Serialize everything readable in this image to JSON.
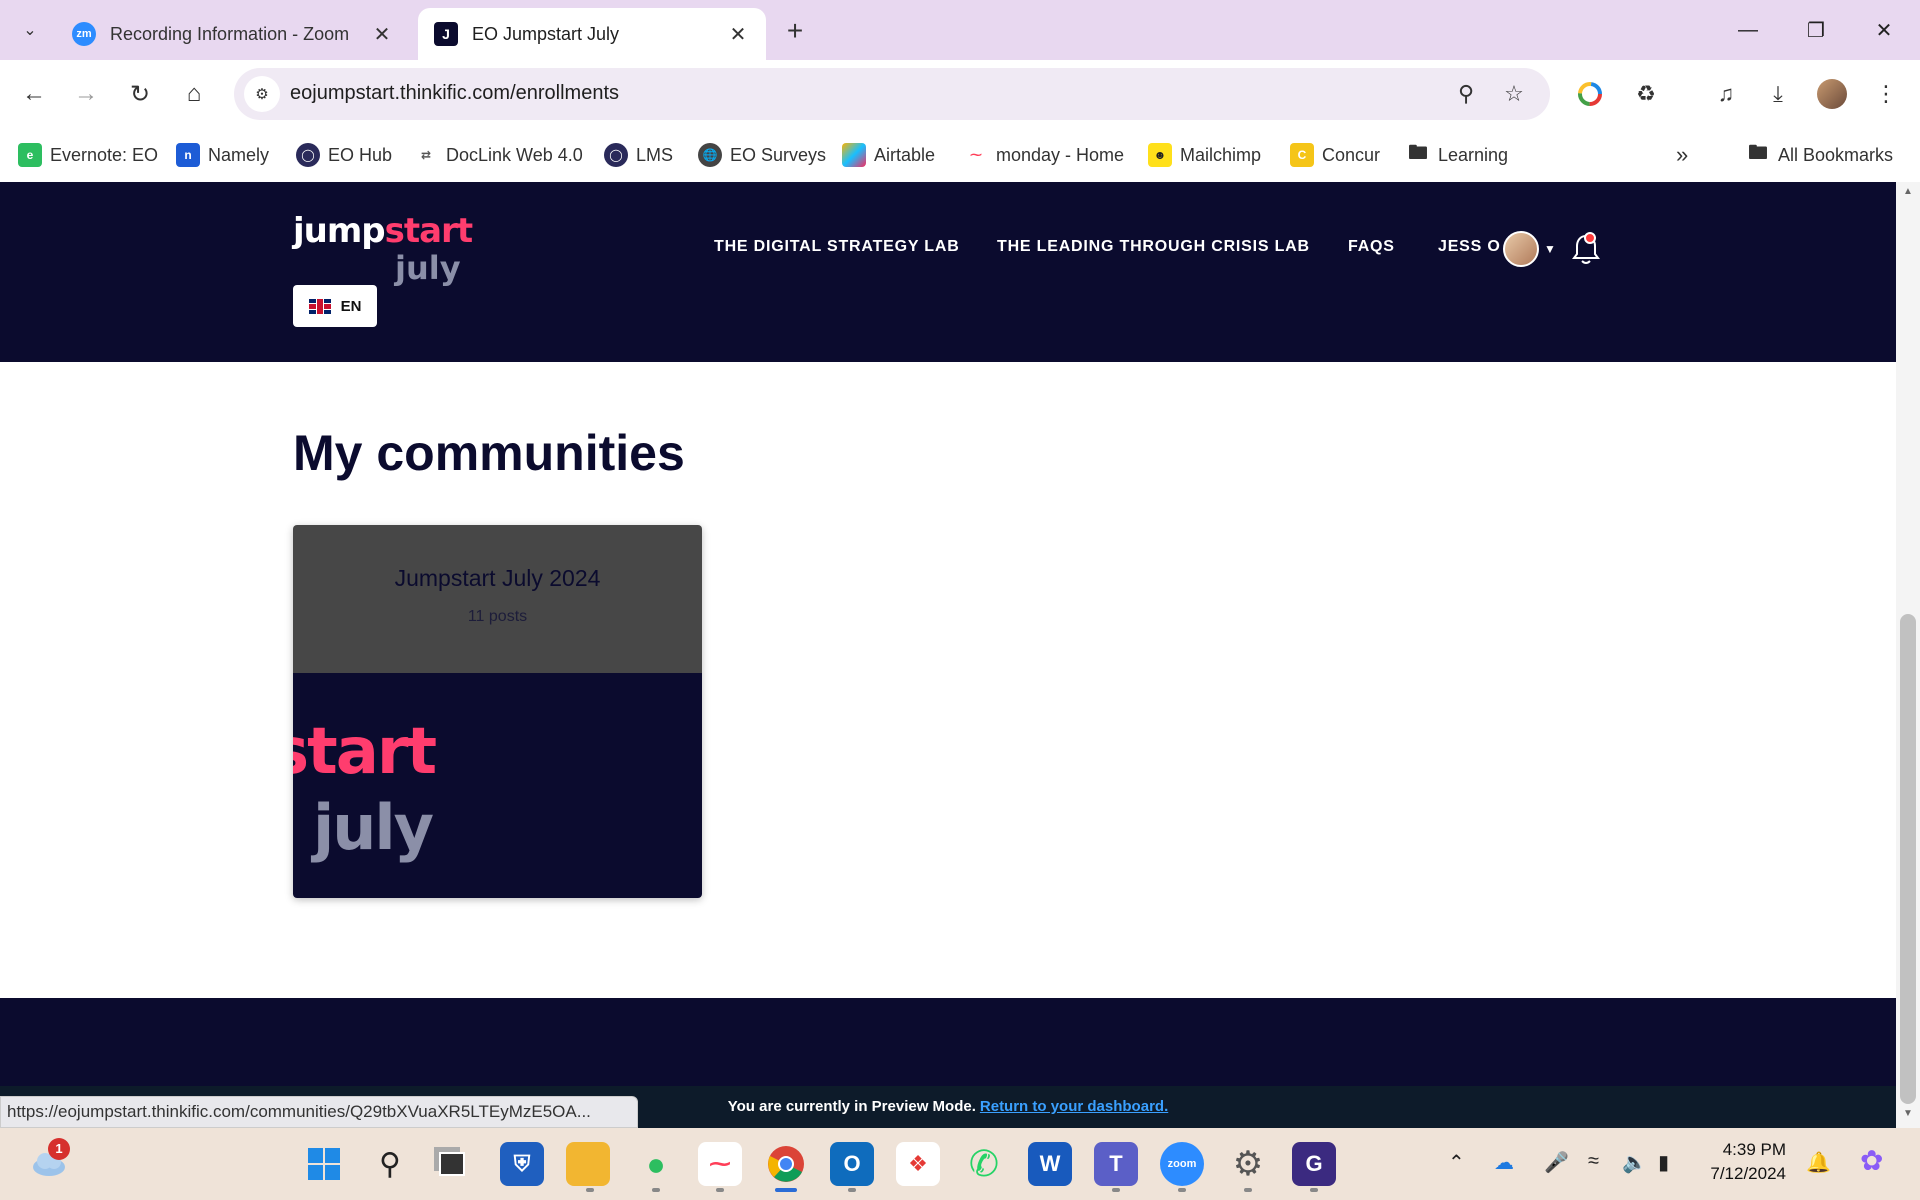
{
  "browser": {
    "tabs": [
      {
        "title": "Recording Information - Zoom",
        "favicon": "zm"
      },
      {
        "title": "EO Jumpstart July",
        "favicon": "J"
      }
    ],
    "url": "eojumpstart.thinkific.com/enrollments",
    "status_url": "https://eojumpstart.thinkific.com/communities/Q29tbXVuaXR5LTEyMzE5OA..."
  },
  "bookmarks": [
    {
      "label": "Evernote: EO",
      "color": "#2dbe60"
    },
    {
      "label": "Namely",
      "color": "#1d5cd6"
    },
    {
      "label": "EO Hub",
      "color": "#2a2a5a"
    },
    {
      "label": "DocLink Web 4.0",
      "color": "#555555"
    },
    {
      "label": "LMS",
      "color": "#2a2a5a"
    },
    {
      "label": "EO Surveys",
      "color": "#444444"
    },
    {
      "label": "Airtable",
      "color": "#fcb400"
    },
    {
      "label": "monday - Home",
      "color": "#ff3d57"
    },
    {
      "label": "Mailchimp",
      "color": "#ffe01b"
    },
    {
      "label": "Concur",
      "color": "#f5c518"
    },
    {
      "label": "Learning",
      "color": "#ffffff"
    }
  ],
  "bookmarks_all": "All Bookmarks",
  "site": {
    "logo_top": "jump",
    "logo_top_accent": "start",
    "logo_bottom": "july",
    "language": "EN",
    "nav": [
      "THE DIGITAL STRATEGY LAB",
      "THE LEADING THROUGH CRISIS LAB",
      "FAQS",
      "JESS O"
    ]
  },
  "main": {
    "title": "My communities",
    "communities": [
      {
        "name": "Jumpstart July 2024",
        "posts": "11 posts",
        "image_text_1": "start",
        "image_text_2": "july"
      }
    ]
  },
  "preview": {
    "text": "You are currently in Preview Mode.",
    "link": "Return to your dashboard."
  },
  "taskbar": {
    "weather_badge": "1",
    "time": "4:39 PM",
    "date": "7/12/2024"
  },
  "colors": {
    "navy": "#0b0b2e",
    "accent_pink": "#ff3d6e",
    "link_blue": "#3aa0ff"
  }
}
